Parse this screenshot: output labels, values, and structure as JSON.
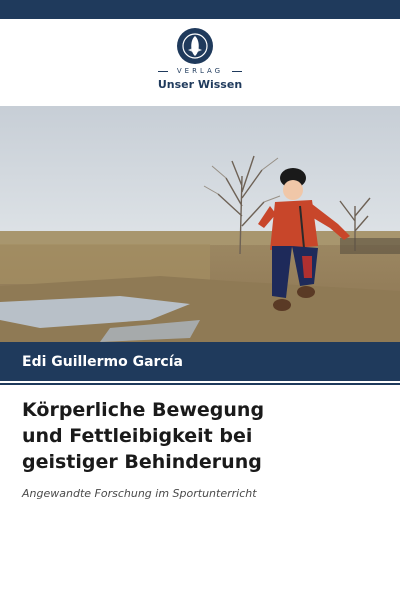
{
  "publisher": {
    "label_top": "VERLAG",
    "name": "Unser Wissen",
    "logo_icon": "globe-book-icon",
    "colors": {
      "brand": "#1f3a5c"
    }
  },
  "author": {
    "name": "Edi Guillermo García"
  },
  "book": {
    "title_lines": [
      "Körperliche Bewegung",
      "und Fettleibigkeit bei",
      "geistiger Behinderung"
    ],
    "subtitle": "Angewandte Forschung im Sportunterricht"
  },
  "cover_photo": {
    "icon": "child-jumping-photo"
  }
}
